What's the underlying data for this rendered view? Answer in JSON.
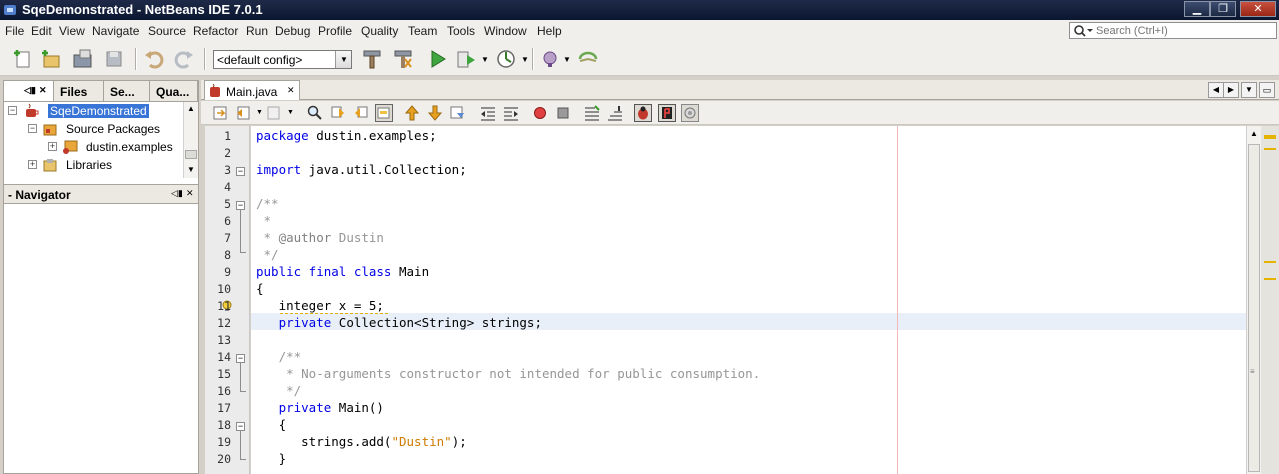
{
  "window": {
    "title": "SqeDemonstrated - NetBeans IDE 7.0.1"
  },
  "menu": [
    "File",
    "Edit",
    "View",
    "Navigate",
    "Source",
    "Refactor",
    "Run",
    "Debug",
    "Profile",
    "Quality",
    "Team",
    "Tools",
    "Window",
    "Help"
  ],
  "search": {
    "placeholder": "Search (Ctrl+I)"
  },
  "toolbar": {
    "config": "<default config>"
  },
  "left_tabs": [
    "Files",
    "Se...",
    "Qua..."
  ],
  "tree": {
    "project": "SqeDemonstrated",
    "source_packages": "Source Packages",
    "package": "dustin.examples",
    "libraries": "Libraries"
  },
  "navigator": {
    "title": "- Navigator"
  },
  "editor": {
    "tab": "Main.java",
    "line_numbers": [
      "1",
      "2",
      "3",
      "4",
      "5",
      "6",
      "7",
      "8",
      "9",
      "10",
      "11",
      "12",
      "13",
      "14",
      "15",
      "16",
      "17",
      "18",
      "19",
      "20"
    ],
    "code": [
      [
        {
          "t": "package",
          "c": "kw"
        },
        {
          "t": " dustin.examples;",
          "c": "pl"
        }
      ],
      [],
      [
        {
          "t": "import",
          "c": "kw"
        },
        {
          "t": " java.util.Collection;",
          "c": "pl"
        }
      ],
      [],
      [
        {
          "t": "/**",
          "c": "cm"
        }
      ],
      [
        {
          "t": " *",
          "c": "cm"
        }
      ],
      [
        {
          "t": " * ",
          "c": "cm"
        },
        {
          "t": "@author",
          "c": "cmkw"
        },
        {
          "t": " Dustin",
          "c": "cm"
        }
      ],
      [
        {
          "t": " */",
          "c": "cm"
        }
      ],
      [
        {
          "t": "public final class",
          "c": "kw"
        },
        {
          "t": " Main",
          "c": "pl"
        }
      ],
      [
        {
          "t": "{",
          "c": "pl"
        }
      ],
      [
        {
          "t": "   integer x = 5;",
          "c": "pl"
        }
      ],
      [
        {
          "t": "   ",
          "c": "pl"
        },
        {
          "t": "private",
          "c": "kw"
        },
        {
          "t": " Collection<String> strings;",
          "c": "pl"
        }
      ],
      [],
      [
        {
          "t": "   /**",
          "c": "cm"
        }
      ],
      [
        {
          "t": "    * No-arguments constructor not intended for public consumption.",
          "c": "cm"
        }
      ],
      [
        {
          "t": "    */",
          "c": "cm"
        }
      ],
      [
        {
          "t": "   ",
          "c": "pl"
        },
        {
          "t": "private",
          "c": "kw"
        },
        {
          "t": " Main()",
          "c": "pl"
        }
      ],
      [
        {
          "t": "   {",
          "c": "pl"
        }
      ],
      [
        {
          "t": "      strings.add(",
          "c": "pl"
        },
        {
          "t": "\"Dustin\"",
          "c": "str"
        },
        {
          "t": ");",
          "c": "pl"
        }
      ],
      [
        {
          "t": "   }",
          "c": "pl"
        }
      ]
    ]
  }
}
